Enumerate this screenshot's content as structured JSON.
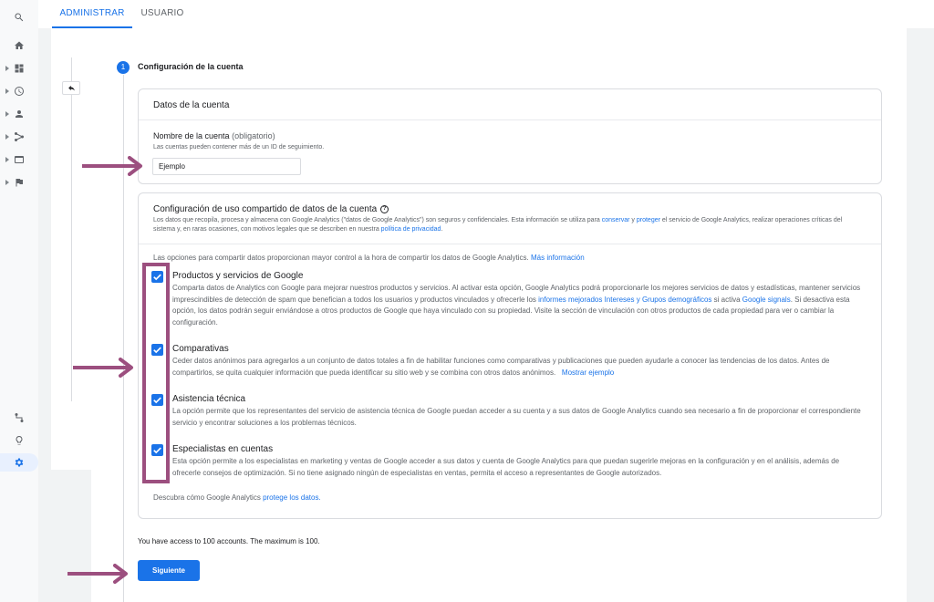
{
  "tabs": [
    {
      "label": "ADMINISTRAR",
      "active": true
    },
    {
      "label": "USUARIO",
      "active": false
    }
  ],
  "nav_icons": [
    "search-icon",
    "home-icon",
    "dashboard-icon",
    "clock-icon",
    "person-icon",
    "acquisition-icon",
    "behavior-icon",
    "flag-icon",
    "route-icon",
    "lightbulb-icon",
    "gear-icon"
  ],
  "step": {
    "number": "1",
    "title": "Configuración de la cuenta"
  },
  "account_card": {
    "title": "Datos de la cuenta",
    "field_label": "Nombre de la cuenta",
    "field_optional": "(obligatorio)",
    "field_hint": "Las cuentas pueden contener más de un ID de seguimiento.",
    "field_value": "Ejemplo"
  },
  "sharing_card": {
    "title": "Configuración de uso compartido de datos de la cuenta",
    "desc_part1": "Los datos que recopila, procesa y almacena con Google Analytics (\"datos de Google Analytics\") son seguros y confidenciales. Esta información se utiliza para ",
    "desc_link1": "conservar",
    "desc_part2": " y ",
    "desc_link2": "proteger",
    "desc_part3": " el servicio de Google Analytics, realizar operaciones críticas del sistema y, en raras ocasiones, con motivos legales que se describen en nuestra ",
    "desc_link3": "política de privacidad",
    "desc_part4": ".",
    "intro": "Las opciones para compartir datos proporcionan mayor control a la hora de compartir los datos de Google Analytics.",
    "intro_link": "Más información",
    "options": [
      {
        "title": "Productos y servicios de Google",
        "checked": true,
        "desc_a": "Comparta datos de Analytics con Google para mejorar nuestros productos y servicios. Al activar esta opción, Google Analytics podrá proporcionarle los mejores servicios de datos y estadísticas, mantener servicios imprescindibles de detección de spam que benefician a todos los usuarios y productos vinculados y ofrecerle los ",
        "link_a": "informes mejorados Intereses y Grupos demográficos",
        "desc_b": " si activa ",
        "link_b": "Google signals",
        "desc_c": ". Si desactiva esta opción, los datos podrán seguir enviándose a otros productos de Google que haya vinculado con su propiedad. Visite la sección de vinculación con otros productos de cada propiedad para ver o cambiar la configuración."
      },
      {
        "title": "Comparativas",
        "checked": true,
        "desc_a": "Ceder datos anónimos para agregarlos a un conjunto de datos totales a fin de habilitar funciones como comparativas y publicaciones que pueden ayudarle a conocer las tendencias de los datos. Antes de compartirlos, se quita cualquier información que pueda identificar su sitio web y se combina con otros datos anónimos.",
        "link_a": "Mostrar ejemplo"
      },
      {
        "title": "Asistencia técnica",
        "checked": true,
        "desc_a": "La opción permite que los representantes del servicio de asistencia técnica de Google puedan acceder a su cuenta y a sus datos de Google Analytics cuando sea necesario a fin de proporcionar el correspondiente servicio y encontrar soluciones a los problemas técnicos."
      },
      {
        "title": "Especialistas en cuentas",
        "checked": true,
        "desc_a": "Esta opción permite a los especialistas en marketing y ventas de Google acceder a sus datos y cuenta de Google Analytics para que puedan sugerirle mejoras en la configuración y en el análisis, además de ofrecerle consejos de optimización. Si no tiene asignado ningún de especialistas en ventas, permita el acceso a representantes de Google autorizados."
      }
    ],
    "footer_text": "Descubra cómo Google Analytics ",
    "footer_link": "protege los datos."
  },
  "access_note": "You have access to 100 accounts. The maximum is 100.",
  "next_button": "Siguiente",
  "colors": {
    "accent": "#1a73e8",
    "annotation": "#9c4f7f"
  }
}
